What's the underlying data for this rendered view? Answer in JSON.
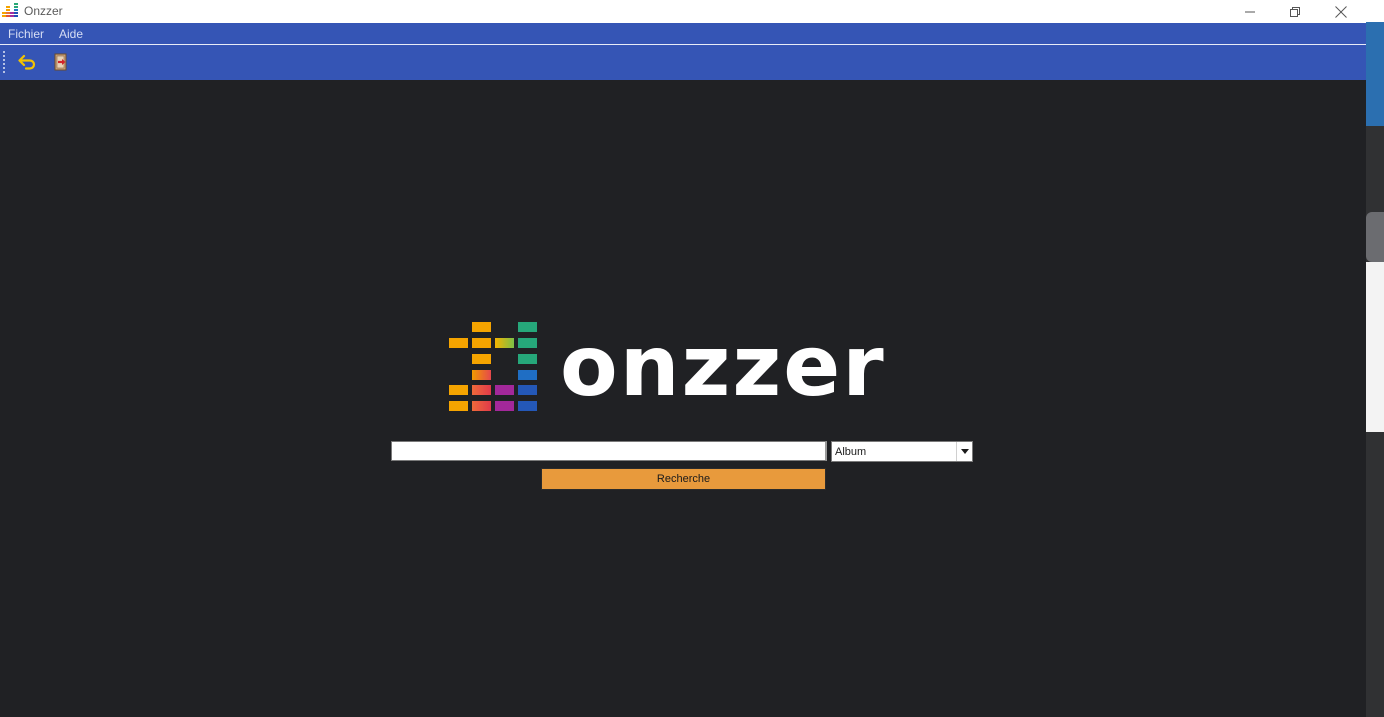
{
  "window": {
    "title": "Onzzer",
    "icon": "equalizer-app-icon",
    "controls": {
      "minimize": "minimize-icon",
      "restore": "restore-icon",
      "close": "close-icon"
    }
  },
  "menu": {
    "items": [
      {
        "label": "Fichier"
      },
      {
        "label": "Aide"
      }
    ]
  },
  "toolbar": {
    "items": [
      {
        "icon": "back-arrow-icon"
      },
      {
        "icon": "exit-door-icon"
      }
    ]
  },
  "logo": {
    "text": "onzzer",
    "icon": "equalizer-bars-logo"
  },
  "search": {
    "query": "",
    "type_selected": "Album",
    "button_label": "Recherche"
  },
  "colors": {
    "bar_blue": "#3555b5",
    "background": "#202124",
    "button_orange": "#e89a3c"
  }
}
